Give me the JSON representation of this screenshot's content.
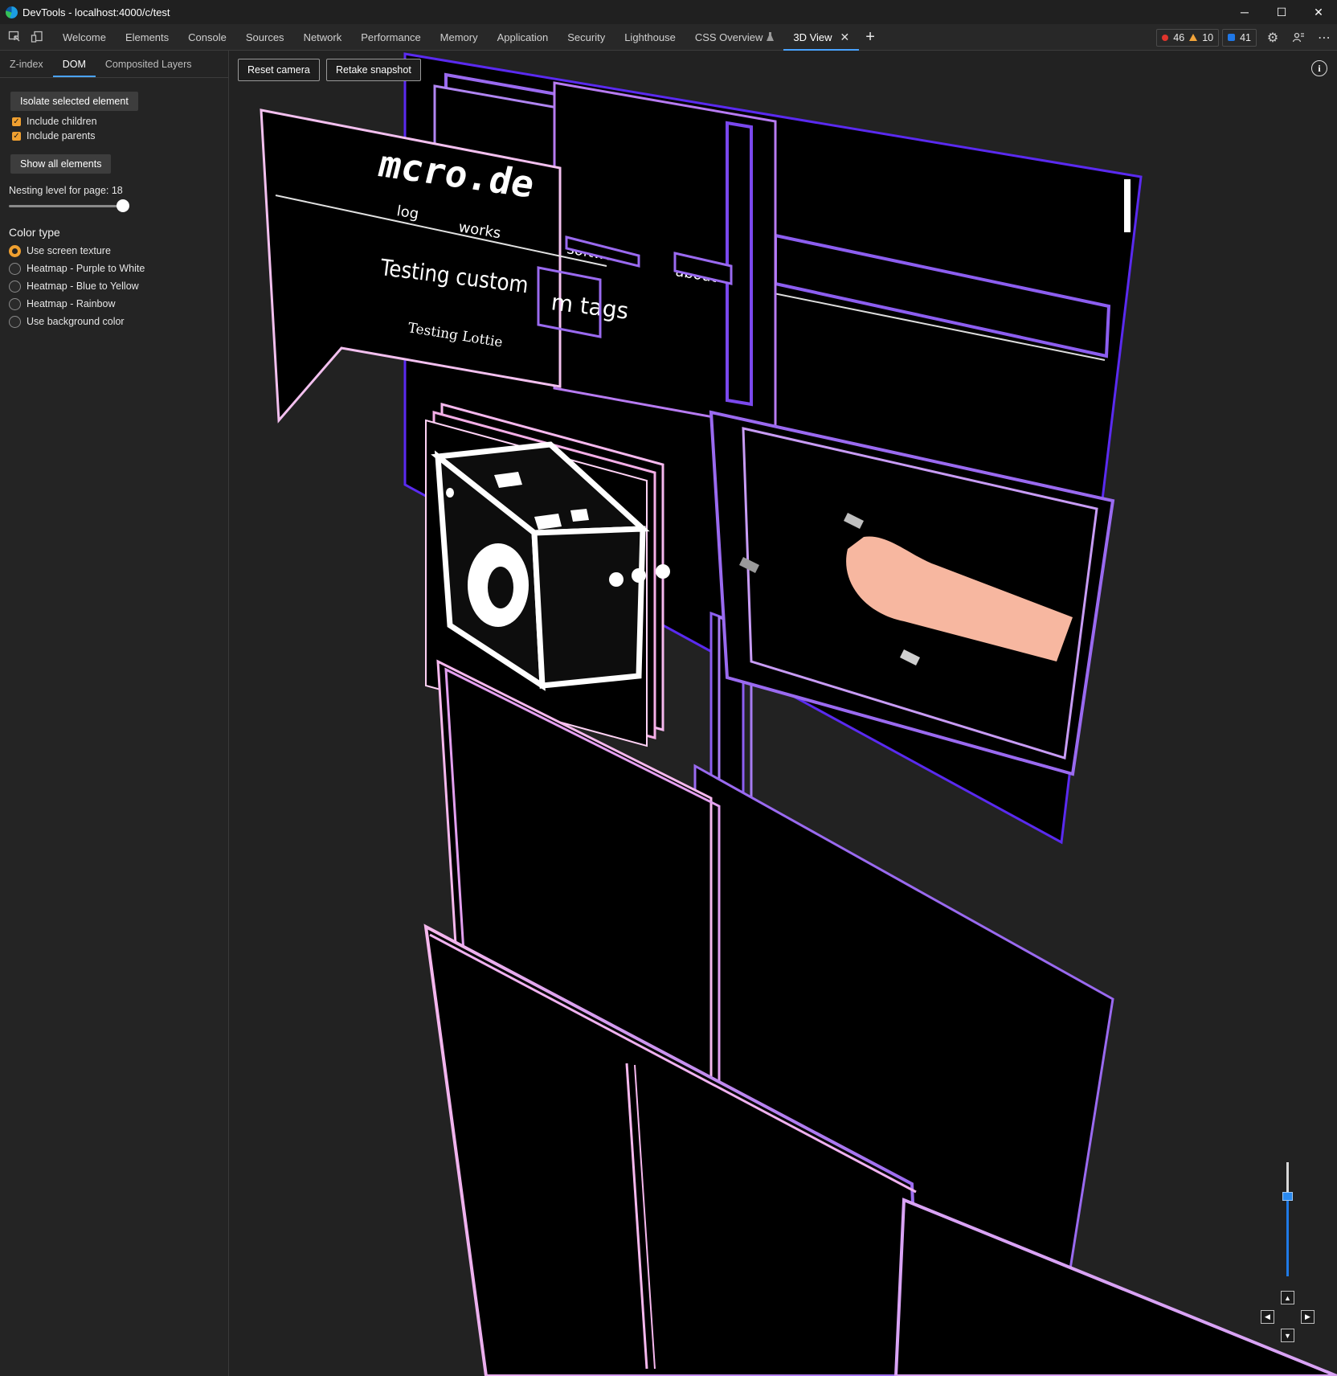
{
  "window": {
    "title": "DevTools - localhost:4000/c/test",
    "minimize_label": "─",
    "maximize_label": "☐",
    "close_label": "✕"
  },
  "toolbar": {
    "tabs": [
      {
        "label": "Welcome"
      },
      {
        "label": "Elements"
      },
      {
        "label": "Console"
      },
      {
        "label": "Sources"
      },
      {
        "label": "Network"
      },
      {
        "label": "Performance"
      },
      {
        "label": "Memory"
      },
      {
        "label": "Application"
      },
      {
        "label": "Security"
      },
      {
        "label": "Lighthouse"
      },
      {
        "label": "CSS Overview"
      },
      {
        "label": "3D View"
      }
    ],
    "active_tab": "3D View",
    "close_tab_glyph": "✕",
    "add_tab_glyph": "+",
    "errors_count": "46",
    "warnings_count": "10",
    "issues_count": "41",
    "settings_glyph": "⚙",
    "more_glyph": "⋯"
  },
  "panel": {
    "subtabs": [
      {
        "label": "Z-index"
      },
      {
        "label": "DOM"
      },
      {
        "label": "Composited Layers"
      }
    ],
    "active_subtab": "DOM",
    "isolate_button": "Isolate selected element",
    "include_children": {
      "label": "Include children",
      "checked": true
    },
    "include_parents": {
      "label": "Include parents",
      "checked": true
    },
    "show_all_button": "Show all elements",
    "nesting_label": "Nesting level for page: 18",
    "nesting_level": 18,
    "color_type_heading": "Color type",
    "color_options": [
      {
        "label": "Use screen texture",
        "selected": true
      },
      {
        "label": "Heatmap - Purple to White",
        "selected": false
      },
      {
        "label": "Heatmap - Blue to Yellow",
        "selected": false
      },
      {
        "label": "Heatmap - Rainbow",
        "selected": false
      },
      {
        "label": "Use background color",
        "selected": false
      }
    ]
  },
  "viewport": {
    "reset_camera": "Reset camera",
    "retake_snapshot": "Retake snapshot",
    "info_glyph": "i",
    "scene_text": {
      "logo": "mcro.de",
      "nav_log": "log",
      "nav_works": "works",
      "nav_software": "software",
      "nav_about": "about",
      "heading": "Testing custom",
      "heading_tail": "m tags",
      "subheading": "Testing Lottie"
    },
    "zoom_level": 0.3,
    "pan_up": "▲",
    "pan_down": "▼",
    "pan_left": "◀",
    "pan_right": "▶",
    "colors": {
      "accent": "#4aa3ff",
      "pink_edge": "#f6b8ee",
      "purple_edge": "#9a6af0",
      "deep_purple_edge": "#5a2af0",
      "skin": "#f7b7a0"
    }
  }
}
